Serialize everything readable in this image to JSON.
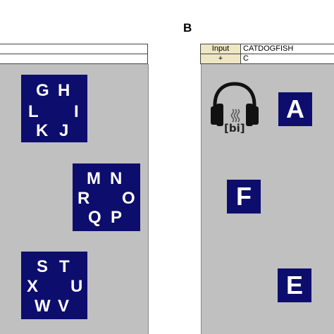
{
  "panel_b": {
    "label": "B",
    "table": {
      "row1": {
        "header": "Input",
        "value": "CATDOGFISH"
      },
      "row2": {
        "header": "+",
        "value": "C"
      }
    },
    "headphones_icon": "headphones-icon",
    "phoneme_label": "[bi]",
    "tiles": [
      "A",
      "F",
      "E"
    ]
  },
  "panel_a": {
    "tiles": [
      {
        "letters": [
          "G",
          "H",
          "L",
          "I",
          "K",
          "J"
        ]
      },
      {
        "letters": [
          "M",
          "N",
          "R",
          "O",
          "Q",
          "P"
        ]
      },
      {
        "letters": [
          "S",
          "T",
          "X",
          "U",
          "W",
          "V"
        ]
      }
    ]
  },
  "colors": {
    "stage_bg": "#c0c0c0",
    "tile_bg": "#0d0d6e",
    "tile_text": "#ffffff",
    "table_header_bg": "#efe6c4"
  }
}
